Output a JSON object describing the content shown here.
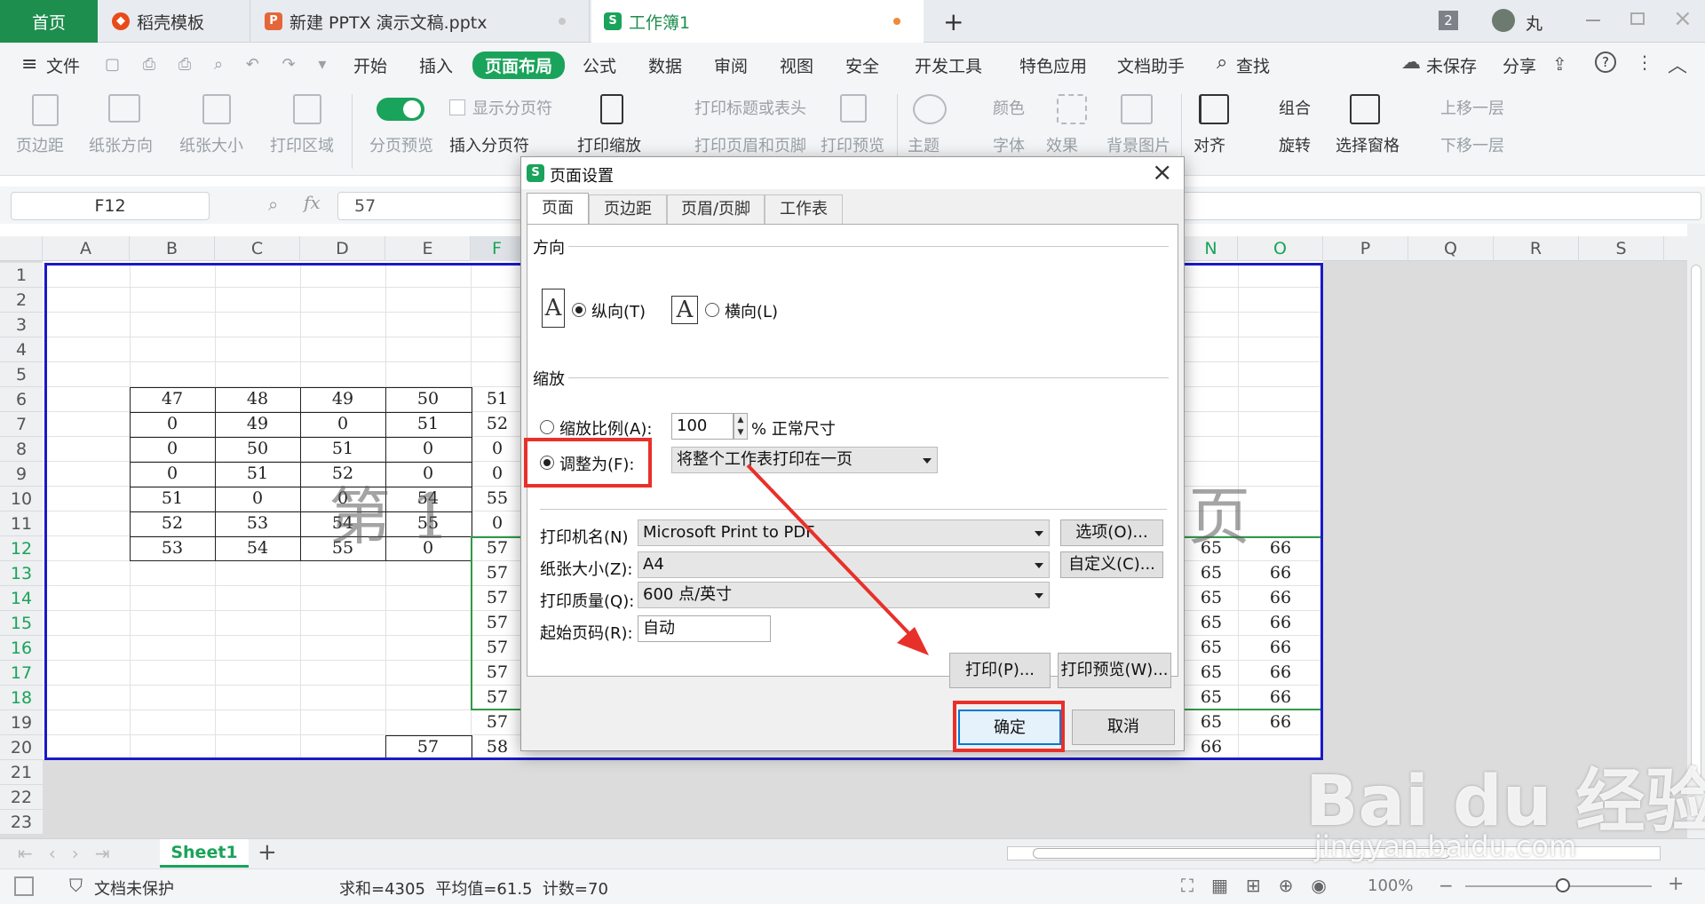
{
  "tabs": [
    {
      "label": "首页"
    },
    {
      "label": "稻壳模板"
    },
    {
      "label": "新建 PPTX 演示文稿.pptx"
    },
    {
      "label": "工作簿1"
    }
  ],
  "window": {
    "badge": "2",
    "user": "丸"
  },
  "menu": {
    "file": "文件",
    "items": [
      "开始",
      "插入",
      "页面布局",
      "公式",
      "数据",
      "审阅",
      "视图",
      "安全",
      "开发工具",
      "特色应用",
      "文档助手"
    ],
    "active": "页面布局",
    "search": "查找",
    "unsaved": "未保存",
    "share": "分享"
  },
  "ribbon": {
    "margins": "页边距",
    "orientation": "纸张方向",
    "size": "纸张大小",
    "print_area": "打印区域",
    "page_break_preview": "分页预览",
    "show_breaks": "显示分页符",
    "insert_break": "插入分页符",
    "print_scale": "打印缩放",
    "print_titles": "打印标题或表头",
    "print_header_footer": "打印页眉和页脚",
    "print_preview": "打印预览",
    "theme": "主题",
    "colors": "颜色",
    "fonts": "字体",
    "effects": "效果",
    "bg_image": "背景图片",
    "align": "对齐",
    "group": "组合",
    "rotate": "旋转",
    "select_pane": "选择窗格",
    "bring_forward": "上移一层",
    "send_backward": "下移一层"
  },
  "formula_bar": {
    "cell_ref": "F12",
    "fx": "fx",
    "value": "57"
  },
  "columns": [
    "A",
    "B",
    "C",
    "D",
    "E",
    "F",
    "N",
    "O",
    "P",
    "Q",
    "R",
    "S"
  ],
  "rows": [
    "1",
    "2",
    "3",
    "4",
    "5",
    "6",
    "7",
    "8",
    "9",
    "10",
    "11",
    "12",
    "13",
    "14",
    "15",
    "16",
    "17",
    "18",
    "19",
    "20",
    "21",
    "22",
    "23"
  ],
  "table": {
    "B": [
      "47",
      "0",
      "0",
      "0",
      "51",
      "52",
      "53"
    ],
    "C": [
      "48",
      "49",
      "50",
      "51",
      "0",
      "53",
      "54"
    ],
    "D": [
      "49",
      "0",
      "51",
      "52",
      "0",
      "54",
      "55"
    ],
    "E": [
      "50",
      "51",
      "0",
      "0",
      "54",
      "55",
      "0"
    ],
    "F": [
      "51",
      "52",
      "0",
      "0",
      "55",
      "0",
      "57",
      "57",
      "57",
      "57",
      "57",
      "57",
      "57",
      "57",
      "58"
    ],
    "N": [
      "65",
      "65",
      "65",
      "65",
      "65",
      "65",
      "65",
      "65",
      "66"
    ],
    "O": [
      "66",
      "66",
      "66",
      "66",
      "66",
      "66",
      "66",
      "66"
    ],
    "E20": "57"
  },
  "watermark": {
    "left": "第 1",
    "right": "页"
  },
  "dialog": {
    "title": "页面设置",
    "tabs": [
      "页面",
      "页边距",
      "页眉/页脚",
      "工作表"
    ],
    "orientation_label": "方向",
    "portrait": "纵向(T)",
    "landscape": "横向(L)",
    "scaling_label": "缩放",
    "scale_ratio": "缩放比例(A):",
    "scale_value": "100",
    "scale_suffix": "% 正常尺寸",
    "fit_to": "调整为(F):",
    "fit_option": "将整个工作表打印在一页",
    "printer_label": "打印机名(N)",
    "printer_value": "Microsoft Print to PDF",
    "options_btn": "选项(O)...",
    "paper_label": "纸张大小(Z):",
    "paper_value": "A4",
    "custom_btn": "自定义(C)...",
    "quality_label": "打印质量(Q):",
    "quality_value": "600 点/英寸",
    "first_page_label": "起始页码(R):",
    "first_page_value": "自动",
    "print_btn": "打印(P)...",
    "preview_btn": "打印预览(W)...",
    "ok_btn": "确定",
    "cancel_btn": "取消"
  },
  "sheet_tab": "Sheet1",
  "status": {
    "protect": "文档未保护",
    "stats": "求和=4305  平均值=61.5  计数=70",
    "zoom": "100%"
  },
  "baidu": {
    "logo": "Bai du 经验",
    "url": "jingyan.baidu.com"
  },
  "colors": {
    "accent": "#1aa35a",
    "annotation": "#e8302a",
    "page_border": "#1a1ac8",
    "selection": "#2e9a47"
  }
}
